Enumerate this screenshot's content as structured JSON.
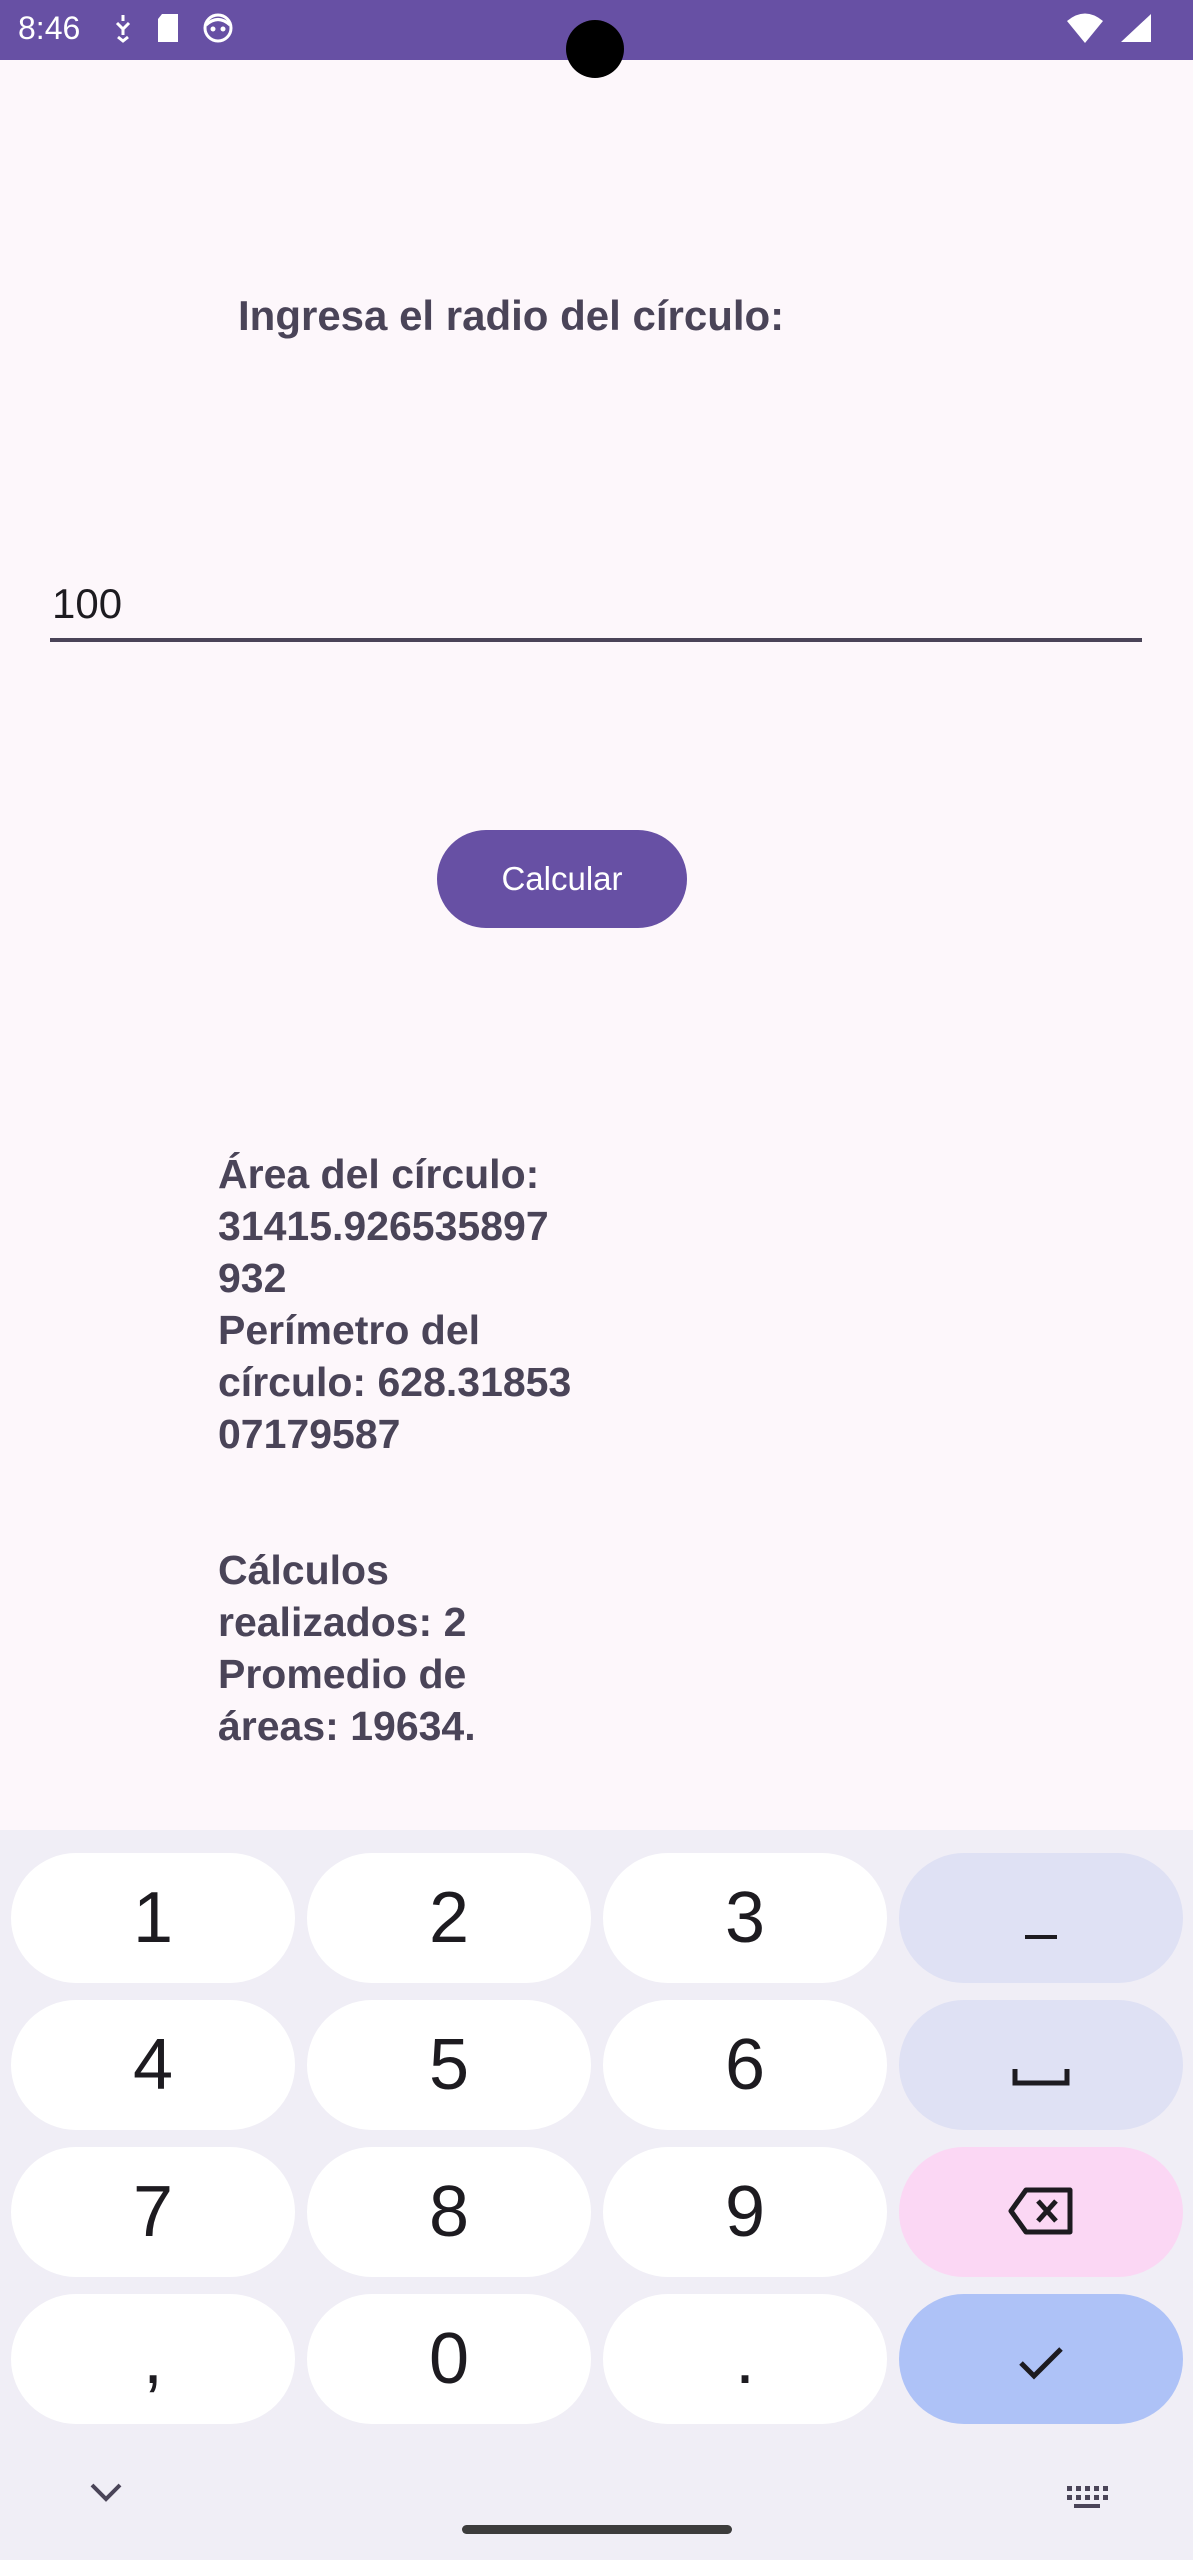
{
  "status_bar": {
    "time": "8:46",
    "icons_left": [
      "sync-icon",
      "sd-card-icon",
      "face-icon"
    ],
    "icons_right": [
      "wifi-icon",
      "signal-icon"
    ],
    "background": "#6750a4"
  },
  "main": {
    "prompt_label": "Ingresa el radio del círculo:",
    "radius_input": {
      "value": "100",
      "placeholder": ""
    },
    "calculate_button": "Calcular",
    "result_lines": [
      "Área del círculo:",
      "31415.926535897",
      "932",
      "Perímetro del",
      "círculo: 628.31853",
      "07179587"
    ],
    "stats_lines": [
      "Cálculos",
      "realizados: 2",
      "Promedio de",
      "áreas: 19634."
    ]
  },
  "keyboard": {
    "keys": [
      [
        "1",
        "2",
        "3",
        "–"
      ],
      [
        "4",
        "5",
        "6",
        "␣"
      ],
      [
        "7",
        "8",
        "9",
        "⌫"
      ],
      [
        ",",
        "0",
        ".",
        "✓"
      ]
    ],
    "colors": {
      "background": "#f0eef6",
      "key": "#ffffff",
      "function_key": "#dfe1f4",
      "delete_key": "#fbd7f4",
      "done_key": "#aec2f7"
    }
  },
  "accent_color": "#6750a4"
}
